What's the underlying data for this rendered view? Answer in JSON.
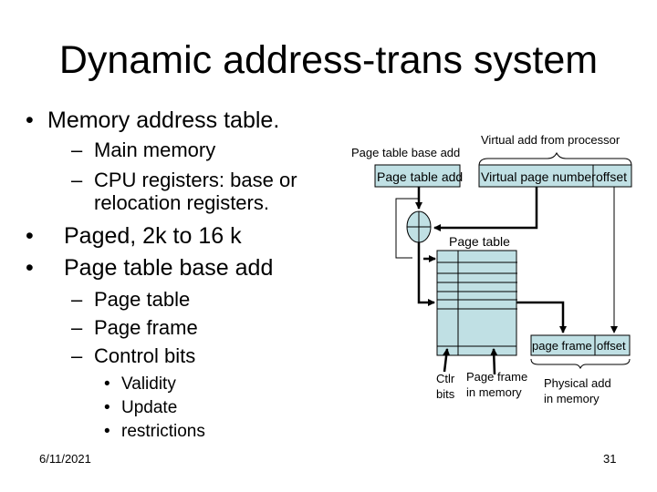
{
  "slide": {
    "title": "Dynamic address-trans system",
    "bullets": {
      "b1": "Memory address table.",
      "b1_sub1": "Main memory",
      "b1_sub2_line1": "CPU registers: base or",
      "b1_sub2_line2": "relocation registers.",
      "b2": "Paged, 2k to 16 k",
      "b3": "Page table base add",
      "b3_sub1": "Page table",
      "b3_sub2": "Page frame",
      "b3_sub3": "Control bits",
      "b3_sub3_items": [
        "Validity",
        "Update",
        "restrictions"
      ]
    },
    "bullet_glyph": "•",
    "dash_glyph": "–",
    "footer": {
      "date": "6/11/2021",
      "page_number": "31"
    }
  },
  "diagram": {
    "box_fill": "#c0e0e4",
    "labels": {
      "virtual_add_from_processor": "Virtual add from processor",
      "page_table_base_add": "Page table base add",
      "page_table_add": "Page table add",
      "virtual_page_number": "Virtual page number",
      "offset_virtual": "offset",
      "page_table": "Page table",
      "page_frame": "page frame",
      "offset_physical": "offset",
      "ctlr_bits_line1": "Ctlr",
      "ctlr_bits_line2": "bits",
      "page_frame_in_memory_line1": "Page frame",
      "page_frame_in_memory_line2": "in memory",
      "physical_add_line1": "Physical add",
      "physical_add_line2": "in memory"
    }
  }
}
